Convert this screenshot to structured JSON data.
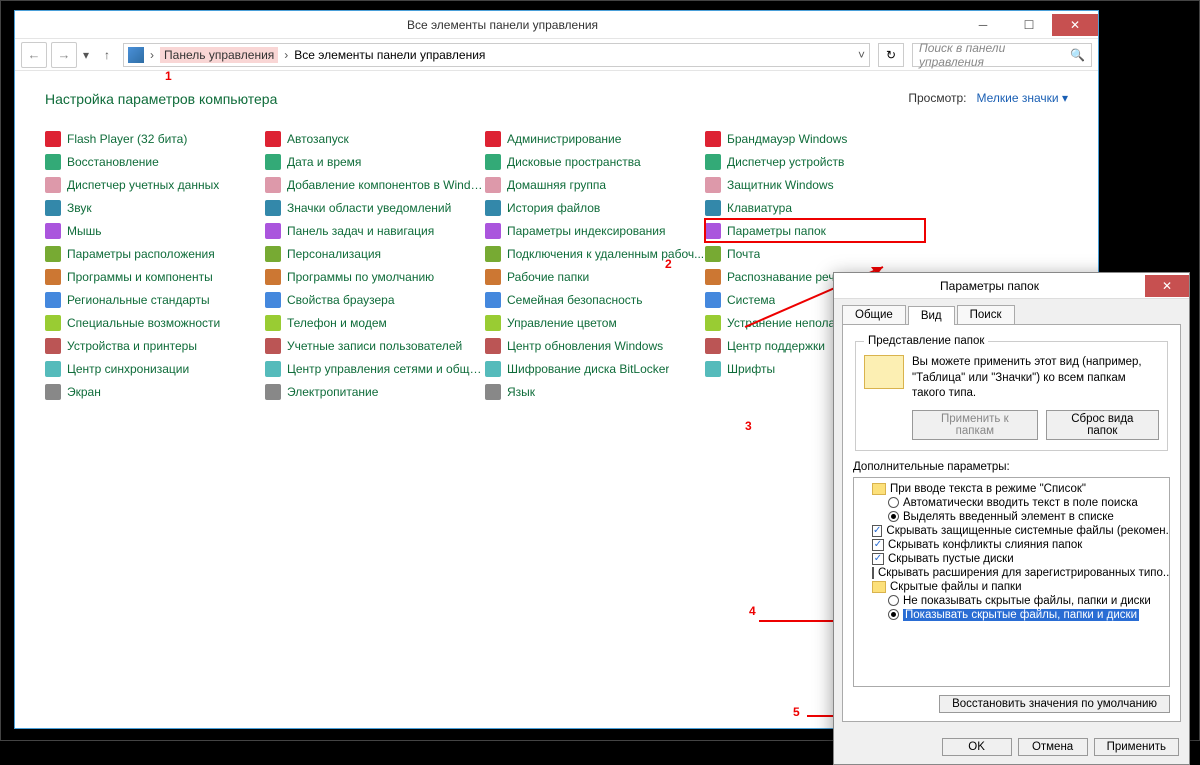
{
  "windowTitle": "Все элементы панели управления",
  "breadcrumb": {
    "root": "Панель управления",
    "page": "Все элементы панели управления"
  },
  "searchPlaceholder": "Поиск в панели управления",
  "heading": "Настройка параметров компьютера",
  "viewLabel": "Просмотр:",
  "viewValue": "Мелкие значки",
  "columns": [
    [
      "Flash Player (32 бита)",
      "Восстановление",
      "Диспетчер учетных данных",
      "Звук",
      "Мышь",
      "Параметры расположения",
      "Программы и компоненты",
      "Региональные стандарты",
      "Специальные возможности",
      "Устройства и принтеры",
      "Центр синхронизации",
      "Экран"
    ],
    [
      "Автозапуск",
      "Дата и время",
      "Добавление компонентов в Windo...",
      "Значки области уведомлений",
      "Панель задач и навигация",
      "Персонализация",
      "Программы по умолчанию",
      "Свойства браузера",
      "Телефон и модем",
      "Учетные записи пользователей",
      "Центр управления сетями и общи...",
      "Электропитание"
    ],
    [
      "Администрирование",
      "Дисковые пространства",
      "Домашняя группа",
      "История файлов",
      "Параметры индексирования",
      "Подключения к удаленным рабоч...",
      "Рабочие папки",
      "Семейная безопасность",
      "Управление цветом",
      "Центр обновления Windows",
      "Шифрование диска BitLocker",
      "Язык"
    ],
    [
      "Брандмауэр Windows",
      "Диспетчер устройств",
      "Защитник Windows",
      "Клавиатура",
      "Параметры папок",
      "Почта",
      "Распознавание речи",
      "Система",
      "Устранение неполадок",
      "Центр поддержки",
      "Шрифты"
    ]
  ],
  "highlightedItem": "Параметры папок",
  "annotations": [
    "1",
    "2",
    "3",
    "4",
    "5"
  ],
  "dialog": {
    "title": "Параметры папок",
    "tabs": [
      "Общие",
      "Вид",
      "Поиск"
    ],
    "activeTab": 1,
    "group1Title": "Представление папок",
    "group1Desc": "Вы можете применить этот вид (например, \"Таблица\" или \"Значки\") ко всем папкам такого типа.",
    "btnApplyFolders": "Применить к папкам",
    "btnResetFolders": "Сброс вида папок",
    "advLabel": "Дополнительные параметры:",
    "tree": [
      {
        "type": "folder",
        "label": "При вводе текста в режиме \"Список\""
      },
      {
        "type": "radio",
        "checked": false,
        "indent": true,
        "label": "Автоматически вводить текст в поле поиска"
      },
      {
        "type": "radio",
        "checked": true,
        "indent": true,
        "label": "Выделять введенный элемент в списке"
      },
      {
        "type": "check",
        "checked": true,
        "label": "Скрывать защищенные системные файлы (рекомен..."
      },
      {
        "type": "check",
        "checked": true,
        "label": "Скрывать конфликты слияния папок"
      },
      {
        "type": "check",
        "checked": true,
        "label": "Скрывать пустые диски"
      },
      {
        "type": "check",
        "checked": false,
        "label": "Скрывать расширения для зарегистрированных типо..."
      },
      {
        "type": "folder",
        "label": "Скрытые файлы и папки"
      },
      {
        "type": "radio",
        "checked": false,
        "indent": true,
        "label": "Не показывать скрытые файлы, папки и диски"
      },
      {
        "type": "radio",
        "checked": true,
        "indent": true,
        "selected": true,
        "label": "Показывать скрытые файлы, папки и диски"
      }
    ],
    "btnRestoreDefaults": "Восстановить значения по умолчанию",
    "btnOk": "OK",
    "btnCancel": "Отмена",
    "btnApply": "Применить"
  }
}
